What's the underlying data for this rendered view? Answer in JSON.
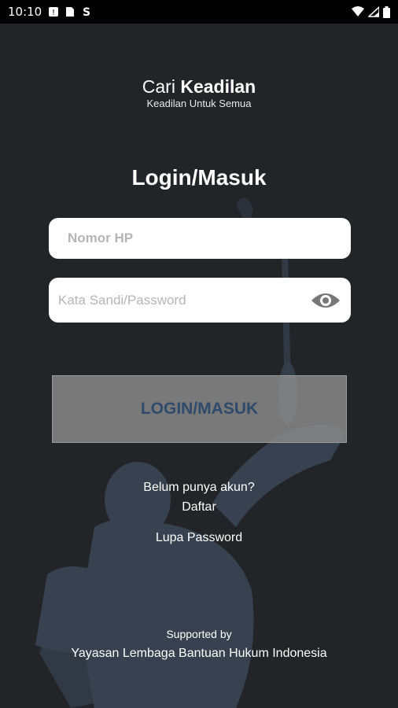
{
  "status_bar": {
    "time": "10:10",
    "icons": [
      "alert-badge-icon",
      "sim-card-icon",
      "sync-icon"
    ],
    "right_icons": [
      "wifi-icon",
      "cell-signal-icon",
      "battery-icon"
    ]
  },
  "brand": {
    "title_light": "Cari",
    "title_bold": "Keadilan",
    "tagline": "Keadilan Untuk Semua"
  },
  "page_title": "Login/Masuk",
  "form": {
    "phone_placeholder": "Nomor HP",
    "phone_value": "",
    "password_placeholder": "Kata Sandi/Password",
    "password_value": "",
    "show_password_icon": "eye-icon",
    "login_label": "LOGIN/MASUK"
  },
  "links": {
    "no_account": "Belum punya akun?",
    "register": "Daftar",
    "forgot_password": "Lupa Password"
  },
  "footer": {
    "supported_by": "Supported by",
    "organization": "Yayasan Lembaga Bantuan Hukum Indonesia"
  },
  "colors": {
    "background": "#222428",
    "button": "#8c8c8c",
    "button_text": "#2f4a6a",
    "field": "#ffffff"
  }
}
